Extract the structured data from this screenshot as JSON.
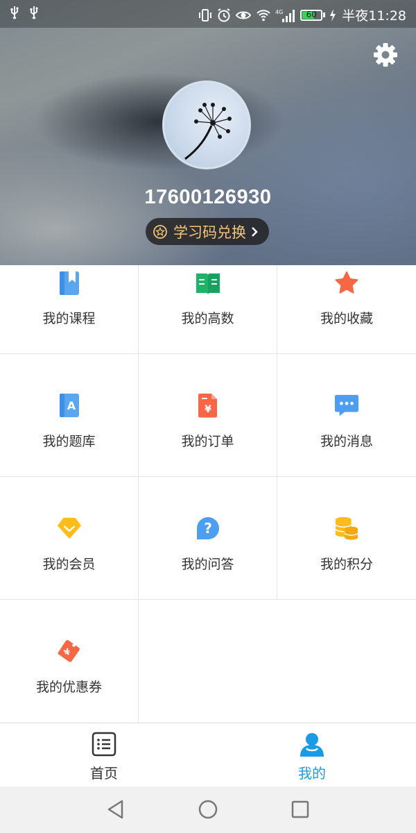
{
  "status_bar": {
    "time": "半夜11:28",
    "battery": "60",
    "network": "4G",
    "icons": [
      "usb-icon",
      "usb-icon",
      "vibrate-icon",
      "alarm-icon",
      "eye-icon",
      "wifi-icon",
      "signal-icon",
      "battery-icon",
      "charging-icon"
    ]
  },
  "profile": {
    "phone": "17600126930",
    "redeem_label": "学习码兑换",
    "avatar_icon": "dandelion-icon",
    "settings_icon": "gear-icon"
  },
  "menu": [
    {
      "label": "我的课程",
      "icon": "bookmark-book-icon"
    },
    {
      "label": "我的高数",
      "icon": "open-book-icon"
    },
    {
      "label": "我的收藏",
      "icon": "star-icon"
    },
    {
      "label": "我的题库",
      "icon": "letter-book-icon"
    },
    {
      "label": "我的订单",
      "icon": "order-document-icon"
    },
    {
      "label": "我的消息",
      "icon": "chat-bubble-icon"
    },
    {
      "label": "我的会员",
      "icon": "diamond-badge-icon"
    },
    {
      "label": "我的问答",
      "icon": "question-bubble-icon"
    },
    {
      "label": "我的积分",
      "icon": "coins-icon"
    },
    {
      "label": "我的优惠券",
      "icon": "coupon-tag-icon"
    }
  ],
  "tabs": [
    {
      "label": "首页",
      "icon": "list-icon",
      "active": false
    },
    {
      "label": "我的",
      "icon": "person-icon",
      "active": true
    }
  ],
  "colors": {
    "accent": "#1a9be6",
    "redeem_text": "#f4c47a",
    "tab_inactive": "#333333",
    "battery_fill": "#3ad25c"
  },
  "nav_icons": [
    "back-triangle-icon",
    "home-circle-icon",
    "recent-square-icon"
  ]
}
